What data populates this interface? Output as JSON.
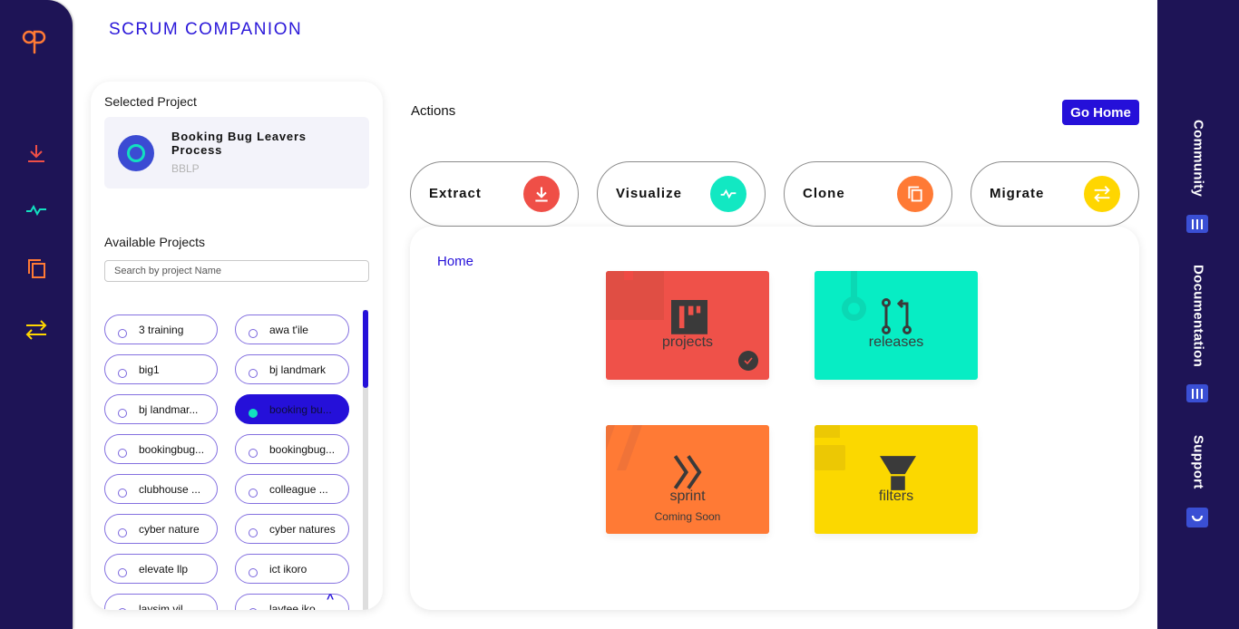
{
  "app": {
    "title": "SCRUM COMPANION"
  },
  "left_rail": {
    "logo": "app-logo",
    "icons": [
      {
        "name": "download-icon",
        "color": "#ef4f47"
      },
      {
        "name": "activity-icon",
        "color": "#12e0c0"
      },
      {
        "name": "copy-icon",
        "color": "#ff7a35"
      },
      {
        "name": "swap-icon",
        "color": "#ffd600"
      }
    ]
  },
  "right_rail": {
    "items": [
      {
        "label": "Community",
        "icon": "bars-icon"
      },
      {
        "label": "Documentation",
        "icon": "bars-icon"
      },
      {
        "label": "Support",
        "icon": "chat-icon"
      }
    ]
  },
  "project_panel": {
    "selected_heading": "Selected Project",
    "selected": {
      "name": "Booking Bug Leavers Process",
      "key": "BBLP"
    },
    "available_heading": "Available Projects",
    "search": {
      "placeholder": "Search by project Name",
      "value": ""
    },
    "projects": [
      {
        "label": "3 training",
        "selected": false
      },
      {
        "label": "awa t'ile",
        "selected": false
      },
      {
        "label": "big1",
        "selected": false
      },
      {
        "label": "bj landmark",
        "selected": false
      },
      {
        "label": "bj landmar...",
        "selected": false
      },
      {
        "label": "booking bu...",
        "selected": true
      },
      {
        "label": "bookingbug...",
        "selected": false
      },
      {
        "label": "bookingbug...",
        "selected": false
      },
      {
        "label": "clubhouse ...",
        "selected": false
      },
      {
        "label": "colleague ...",
        "selected": false
      },
      {
        "label": "cyber nature",
        "selected": false
      },
      {
        "label": "cyber natures",
        "selected": false
      },
      {
        "label": "elevate llp",
        "selected": false
      },
      {
        "label": "ict ikoro",
        "selected": false
      },
      {
        "label": "laysim vil",
        "selected": false
      },
      {
        "label": "laytee iko",
        "selected": false
      }
    ],
    "scroll_position": 0
  },
  "actions": {
    "heading": "Actions",
    "go_home": "Go Home",
    "buttons": [
      {
        "label": "Extract",
        "icon": "download-icon",
        "color": "#ef4f47"
      },
      {
        "label": "Visualize",
        "icon": "activity-icon",
        "color": "#12e8c2"
      },
      {
        "label": "Clone",
        "icon": "copy-icon",
        "color": "#ff7a35"
      },
      {
        "label": "Migrate",
        "icon": "swap-icon",
        "color": "#ffd600"
      }
    ]
  },
  "home": {
    "breadcrumb": "Home",
    "tiles": [
      {
        "label": "projects",
        "sub": "",
        "icon": "board-icon",
        "color": "#ef5149",
        "checked": true
      },
      {
        "label": "releases",
        "sub": "",
        "icon": "pull-request-icon",
        "color": "#07edc4",
        "checked": false
      },
      {
        "label": "sprint",
        "sub": "Coming Soon",
        "icon": "double-chevron-icon",
        "color": "#ff7a35",
        "checked": false
      },
      {
        "label": "filters",
        "sub": "",
        "icon": "funnel-icon",
        "color": "#fbd800",
        "checked": false
      }
    ]
  }
}
